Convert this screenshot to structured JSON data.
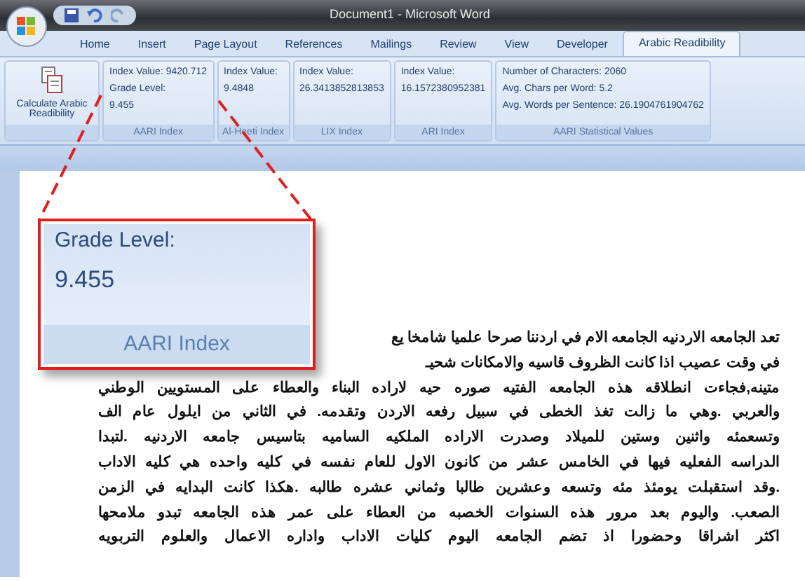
{
  "window": {
    "title": "Document1 - Microsoft Word"
  },
  "tabs": [
    {
      "label": "Home",
      "selected": false
    },
    {
      "label": "Insert",
      "selected": false
    },
    {
      "label": "Page Layout",
      "selected": false
    },
    {
      "label": "References",
      "selected": false
    },
    {
      "label": "Mailings",
      "selected": false
    },
    {
      "label": "Review",
      "selected": false
    },
    {
      "label": "View",
      "selected": false
    },
    {
      "label": "Developer",
      "selected": false
    },
    {
      "label": "Arabic Readibility",
      "selected": true
    }
  ],
  "ribbon_groups": [
    {
      "kind": "button",
      "button_label": "Calculate Arabic Readibility"
    },
    {
      "kind": "values",
      "lines": [
        "Index Value: 9420.712",
        "Grade Level:",
        "9.455"
      ],
      "label": "AARI Index"
    },
    {
      "kind": "values",
      "lines": [
        "Index Value:",
        "9.4848"
      ],
      "label": "Al-Heeti Index"
    },
    {
      "kind": "values",
      "lines": [
        "Index Value:",
        "26.3413852813853"
      ],
      "label": "LIX Index"
    },
    {
      "kind": "values",
      "lines": [
        "Index Value:",
        "16.1572380952381"
      ],
      "label": "ARI Index"
    },
    {
      "kind": "values",
      "lines": [
        "Number of Characters: 2060",
        "Avg. Chars per Word: 5.2",
        "Avg. Words per Sentence: 26.1904761904762"
      ],
      "label": "AARI Statistical Values"
    }
  ],
  "callout": {
    "lines": [
      "Grade Level:",
      "9.455"
    ],
    "label": "AARI Index"
  },
  "document": {
    "lines": [
      "تعد الجامعه الاردنيه الجامعه الام في اردننا صرحا علميا شامخا يع",
      "في وقت عصيب اذا كانت الظروف قاسيه والامكانات شحيـ",
      "متينه,فجاءت انطلاقه هذه الجامعه الفتيه صوره حيه لاراده البناء والعطاء على المستويين الوطني",
      "والعربي .وهي ما زالت تغذ الخطى في سبيل رفعه الاردن وتقدمه. في الثاني من ايلول عام الف",
      "وتسعمئه واثنين وستين للميلاد وصدرت الاراده الملكيه الساميه بتاسيس جامعه الاردنيه .لتبدا",
      "الدراسه الفعليه فيها في الخامس عشر من كانون الاول للعام نفسه في كليه واحده هي كليه الاداب",
      ".وقد استقبلت يومئذ مئه وتسعه وعشرين طالبا وثماني عشره طالبه .هكذا كانت البدايه في الزمن",
      "الصعب. واليوم بعد مرور هذه السنوات الخصبه من العطاء على عمر هذه الجامعه تبدو ملامحها",
      "اكثر اشراقا وحضورا اذ تضم الجامعه اليوم كليات الاداب واداره الاعمال والعلوم التربويه"
    ]
  }
}
